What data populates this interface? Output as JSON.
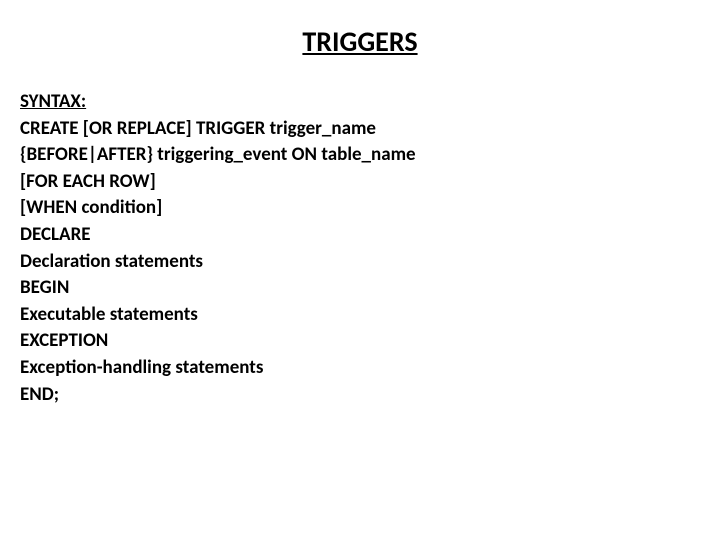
{
  "title": "TRIGGERS",
  "syntaxLabel": "SYNTAX:",
  "lines": {
    "l1": "CREATE [OR REPLACE] TRIGGER trigger_name",
    "l2": "{BEFORE|AFTER} triggering_event ON table_name",
    "l3": "[FOR EACH ROW]",
    "l4": "[WHEN condition]",
    "l5": "DECLARE",
    "l6": "Declaration statements",
    "l7": "BEGIN",
    "l8": "Executable statements",
    "l9": "EXCEPTION",
    "l10": "Exception-handling statements",
    "l11": "END;"
  }
}
